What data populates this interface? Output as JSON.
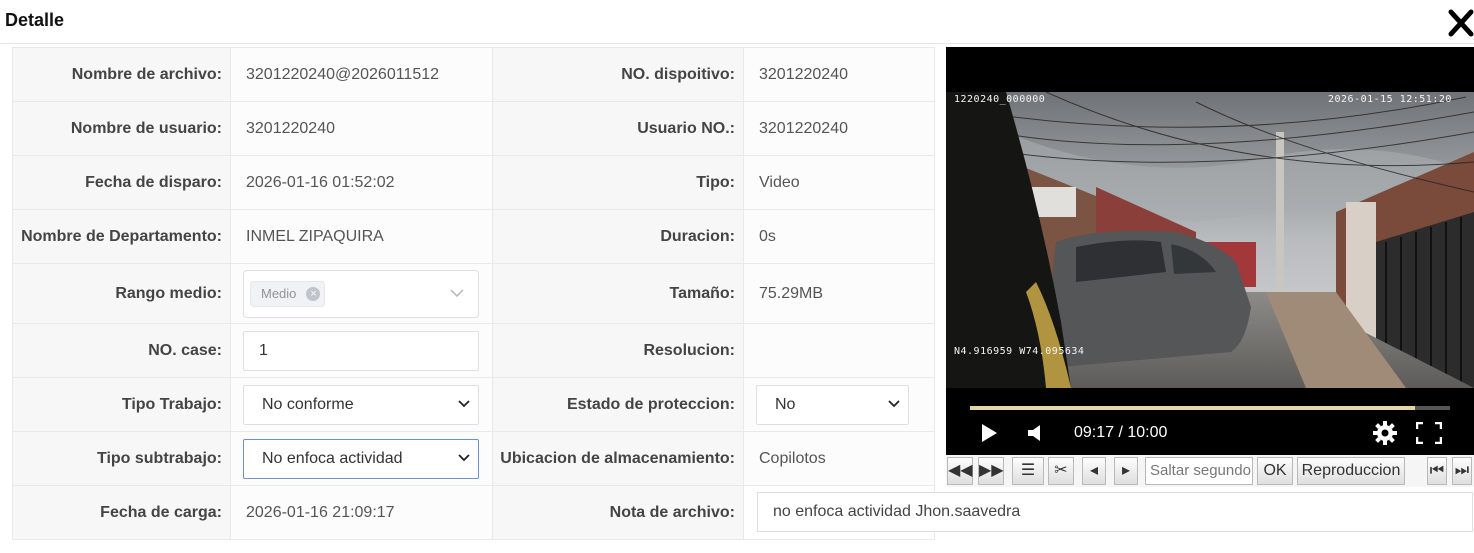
{
  "dialog": {
    "title": "Detalle"
  },
  "fields": {
    "file_name_label": "Nombre de archivo:",
    "file_name_value": "3201220240@2026011512",
    "device_no_label": "NO. dispoitivo:",
    "device_no_value": "3201220240",
    "user_name_label": "Nombre de usuario:",
    "user_name_value": "3201220240",
    "user_no_label": "Usuario NO.:",
    "user_no_value": "3201220240",
    "trigger_date_label": "Fecha de disparo:",
    "trigger_date_value": "2026-01-16 01:52:02",
    "type_label": "Tipo:",
    "type_value": "Video",
    "department_label": "Nombre de Departamento:",
    "department_value": "INMEL ZIPAQUIRA",
    "duration_label": "Duracion:",
    "duration_value": "0s",
    "range_label": "Rango medio:",
    "range_tag": "Medio",
    "size_label": "Tamaño:",
    "size_value": "75.29MB",
    "case_label": "NO. case:",
    "case_value": "1",
    "resolution_label": "Resolucion:",
    "resolution_value": "",
    "work_type_label": "Tipo Trabajo:",
    "work_type_value": "No conforme",
    "protection_label": "Estado de proteccion:",
    "protection_value": "No",
    "subwork_label": "Tipo subtrabajo:",
    "subwork_value": "No enfoca actividad",
    "storage_label": "Ubicacion de almacenamiento:",
    "storage_value": "Copilotos",
    "upload_date_label": "Fecha de carga:",
    "upload_date_value": "2026-01-16 21:09:17",
    "file_note_label": "Nota de archivo:",
    "file_note_value": "no enfoca actividad Jhon.saavedra"
  },
  "player": {
    "osd_top_left": "1220240_000000",
    "osd_top_right": "2026-01-15  12:51:20",
    "osd_gps": "N4.916959  W74.095634",
    "time_display": "09:17 / 10:00",
    "progress_fraction": 0.927
  },
  "toolbar": {
    "seek_placeholder": "Saltar segundo",
    "ok_label": "OK",
    "playback_label": "Reproduccion"
  },
  "icons": [
    "close-icon",
    "chevron-down-icon",
    "tag-close-icon",
    "play-icon",
    "volume-icon",
    "settings-icon",
    "fullscreen-icon",
    "rewind-icon",
    "fast-forward-icon",
    "list-icon",
    "scissors-icon",
    "prev-frame-icon",
    "next-frame-icon",
    "skip-start-icon",
    "skip-end-icon"
  ]
}
